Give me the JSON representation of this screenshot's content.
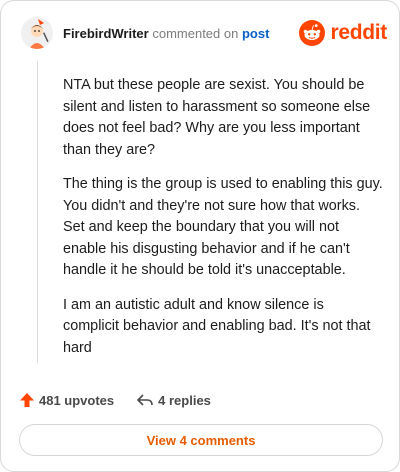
{
  "comment": {
    "author": "FirebirdWriter",
    "action_text": "commented on",
    "post_link": "post",
    "paragraphs": [
      "NTA but these people are sexist. You should be silent and listen to harassment so someone else does not feel bad? Why are you less important than they are?",
      "The thing is the group is used to enabling this guy. You didn't and they're not sure how that works. Set and keep the boundary that you will not enable his disgusting behavior and if he can't handle it he should be told it's unacceptable.",
      "I am an autistic adult and know silence is complicit behavior and enabling bad. It's not that hard"
    ]
  },
  "brand": {
    "name": "reddit",
    "icon": "reddit-alien-icon",
    "color": "#ff4500"
  },
  "actions": {
    "upvotes": "481 upvotes",
    "replies": "4 replies"
  },
  "view_button": {
    "label": "View 4 comments",
    "color": "#e65c00"
  },
  "colors": {
    "link": "#0a61c9",
    "upvote": "#ff4500",
    "muted": "#7c7c7c"
  }
}
